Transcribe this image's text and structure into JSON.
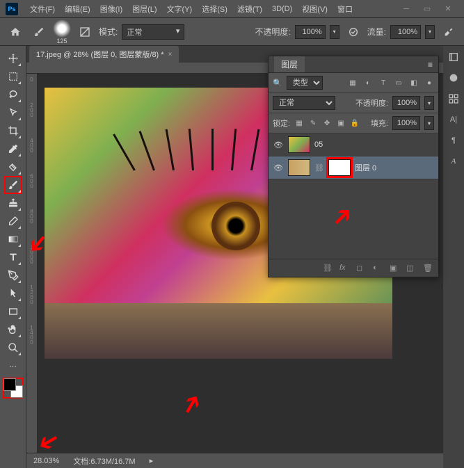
{
  "app": {
    "icon_label": "Ps"
  },
  "menubar": {
    "items": [
      "文件(F)",
      "编辑(E)",
      "图像(I)",
      "图层(L)",
      "文字(Y)",
      "选择(S)",
      "滤镜(T)",
      "3D(D)",
      "视图(V)",
      "窗口"
    ]
  },
  "toolbar": {
    "brush_size": "125",
    "mode_label": "模式:",
    "mode_value": "正常",
    "opacity_label": "不透明度:",
    "opacity_value": "100%",
    "flow_label": "流量:",
    "flow_value": "100%"
  },
  "document": {
    "tab_title": "17.jpeg @ 28% (图层 0, 图层蒙版/8) *"
  },
  "rulers": {
    "v": [
      "0",
      "200",
      "400",
      "600",
      "800",
      "1000",
      "1200",
      "1400"
    ]
  },
  "layers_panel": {
    "title": "图层",
    "type_filter_label": "类型",
    "blend_mode": "正常",
    "opacity_label": "不透明度:",
    "opacity_value": "100%",
    "lock_label": "锁定:",
    "fill_label": "填充:",
    "fill_value": "100%",
    "layers": [
      {
        "name": "05",
        "selected": false,
        "has_mask": false
      },
      {
        "name": "图层 0",
        "selected": true,
        "has_mask": true
      }
    ]
  },
  "statusbar": {
    "zoom": "28.03%",
    "doc_label": "文档:",
    "doc_size": "6.73M/16.7M"
  }
}
